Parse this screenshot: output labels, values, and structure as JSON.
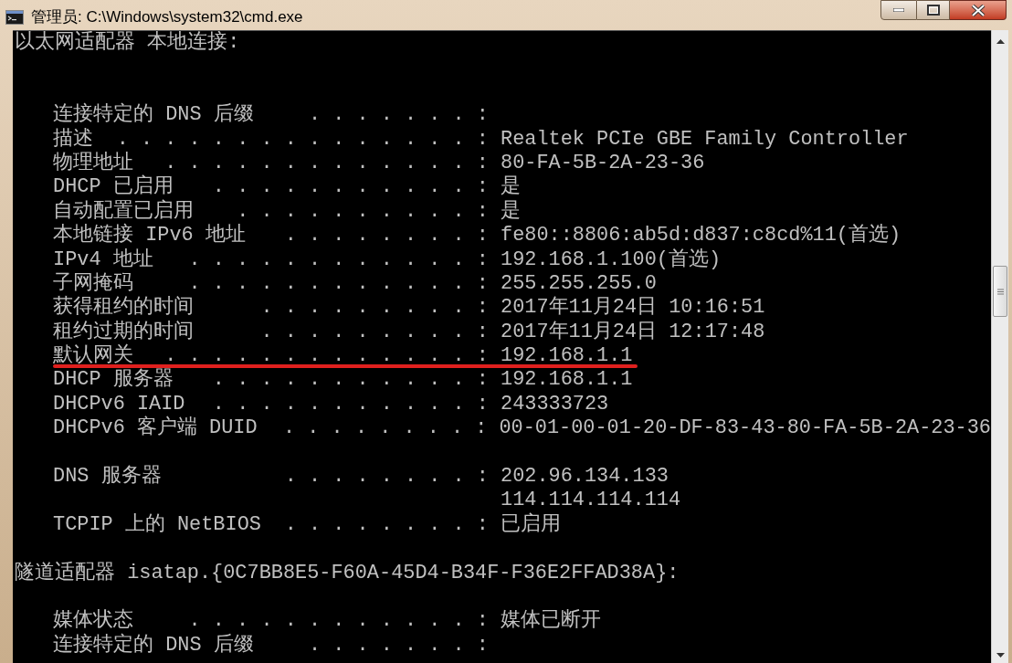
{
  "window": {
    "title": "管理员: C:\\Windows\\system32\\cmd.exe"
  },
  "console": [
    {
      "kind": "header",
      "text": "以太网适配器 本地连接:"
    },
    {
      "kind": "blank"
    },
    {
      "kind": "blank"
    },
    {
      "kind": "entry",
      "label": "连接特定的 DNS 后缀",
      "leader": ". . . . . . . :",
      "underlined": false
    },
    {
      "kind": "entry",
      "label": "描述",
      "leader": ". . . . . . . . . . . . . . . :",
      "value": "Realtek PCIe GBE Family Controller",
      "underlined": false
    },
    {
      "kind": "entry",
      "label": "物理地址",
      "leader": ". . . . . . . . . . . . . :",
      "value": "80-FA-5B-2A-23-36",
      "underlined": false
    },
    {
      "kind": "entry",
      "label": "DHCP 已启用",
      "leader": ". . . . . . . . . . . :",
      "value": "是",
      "underlined": false
    },
    {
      "kind": "entry",
      "label": "自动配置已启用",
      "leader": ". . . . . . . . . . :",
      "value": "是",
      "underlined": false
    },
    {
      "kind": "entry",
      "label": "本地链接 IPv6 地址",
      "leader": ". . . . . . . . :",
      "value": "fe80::8806:ab5d:d837:c8cd%11(首选)",
      "underlined": false
    },
    {
      "kind": "entry",
      "label": "IPv4 地址",
      "leader": ". . . . . . . . . . . . :",
      "value": "192.168.1.100(首选)",
      "underlined": false
    },
    {
      "kind": "entry",
      "label": "子网掩码",
      "leader": ". . . . . . . . . . . . :",
      "value": "255.255.255.0",
      "underlined": false
    },
    {
      "kind": "entry",
      "label": "获得租约的时间",
      "leader": ". . . . . . . . . :",
      "value": "2017年11月24日 10:16:51",
      "underlined": false
    },
    {
      "kind": "entry",
      "label": "租约过期的时间",
      "leader": ". . . . . . . . . :",
      "value": "2017年11月24日 12:17:48",
      "underlined": false
    },
    {
      "kind": "entry",
      "label": "默认网关",
      "leader": ". . . . . . . . . . . . . :",
      "value": "192.168.1.1",
      "underlined": true
    },
    {
      "kind": "entry",
      "label": "DHCP 服务器",
      "leader": ". . . . . . . . . . . :",
      "value": "192.168.1.1",
      "underlined": false
    },
    {
      "kind": "entry",
      "label": "DHCPv6 IAID",
      "leader": ". . . . . . . . . . . :",
      "value": "243333723",
      "underlined": false
    },
    {
      "kind": "entry",
      "label": "DHCPv6 客户端 DUID",
      "leader": ". . . . . . . . :",
      "value": "00-01-00-01-20-DF-83-43-80-FA-5B-2A-23-36",
      "underlined": false
    },
    {
      "kind": "blank"
    },
    {
      "kind": "entry",
      "label": "DNS 服务器",
      "leader": ". . . . . . . . :",
      "value": "202.96.134.133",
      "underlined": false
    },
    {
      "kind": "continuation",
      "value": "114.114.114.114"
    },
    {
      "kind": "entry",
      "label": "TCPIP 上的 NetBIOS",
      "leader": ". . . . . . . . :",
      "value": "已启用",
      "underlined": false
    },
    {
      "kind": "blank"
    },
    {
      "kind": "header",
      "text": "隧道适配器 isatap.{0C7BB8E5-F60A-45D4-B34F-F36E2FFAD38A}:"
    },
    {
      "kind": "blank"
    },
    {
      "kind": "entry",
      "label": "媒体状态",
      "leader": ". . . . . . . . . . . . :",
      "value": "媒体已断开",
      "underlined": false
    },
    {
      "kind": "entry",
      "label": "连接特定的 DNS 后缀",
      "leader": ". . . . . . . :",
      "underlined": false
    }
  ]
}
